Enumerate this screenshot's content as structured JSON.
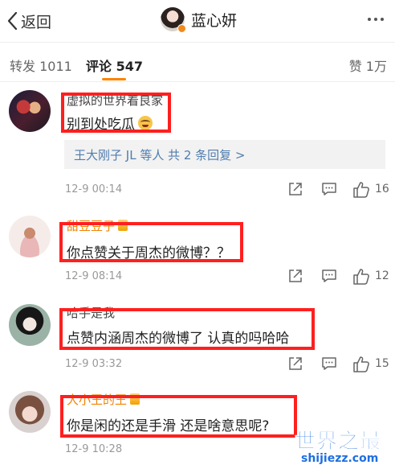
{
  "header": {
    "back_label": "返回",
    "title": "蓝心妍"
  },
  "tabs": {
    "repost": "转发 1011",
    "comments": "评论 547",
    "likes": "赞 1万"
  },
  "comments": [
    {
      "username": "虚拟的世界着良家",
      "text": "别到处吃瓜",
      "emoji": "laughing-face-icon",
      "replies": "王大刚子 JL 等人  共 2 条回复 >",
      "time": "12-9 00:14",
      "likes": "16"
    },
    {
      "username": "甜豆豆子",
      "text": "你点赞关于周杰的微博？？",
      "time": "12-9 08:14",
      "likes": "12"
    },
    {
      "username": "哈手是我",
      "text": "点赞内涵周杰的微博了 认真的吗哈哈",
      "time": "12-9 03:32",
      "likes": "15"
    },
    {
      "username": "大小王的王",
      "text": "你是闲的还是手滑 还是啥意思呢?",
      "time": "12-9 10:28",
      "likes": ""
    }
  ],
  "watermark": {
    "title": "世界之最",
    "url": "shijiezz.com"
  },
  "colors": {
    "highlight_box": "#ff1f1f",
    "accent": "#ff8200",
    "link": "#507daf",
    "vip_name": "#f08300"
  }
}
